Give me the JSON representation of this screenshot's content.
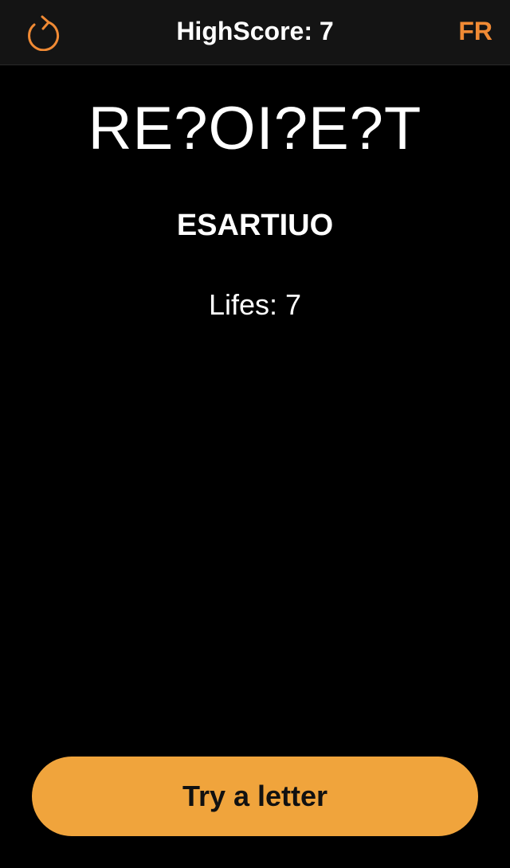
{
  "theme": {
    "accent": "#F0A43C",
    "accent_text": "#F08A34",
    "background": "#000000",
    "navbar_bg": "#141414"
  },
  "navbar": {
    "restart_icon": "refresh-icon",
    "title": "HighScore: 7",
    "language_label": "FR"
  },
  "game": {
    "masked_word": "RE?OI?E?T",
    "tried_letters": "ESARTIUO",
    "lives_text": "Lifes: 7"
  },
  "actions": {
    "try_letter_label": "Try a letter"
  }
}
